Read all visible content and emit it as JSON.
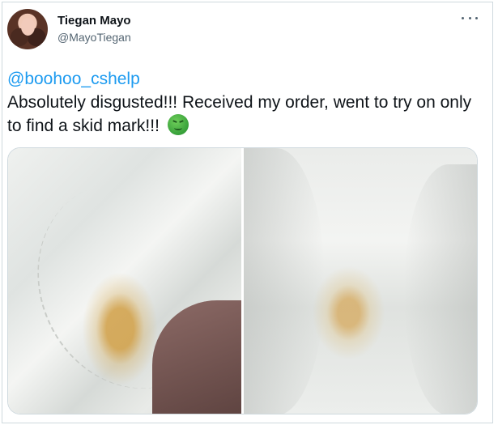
{
  "tweet": {
    "author": {
      "display_name": "Tiegan Mayo",
      "handle": "@MayoTiegan",
      "avatar": "profile-photo"
    },
    "mention": "@boohoo_cshelp",
    "text": "Absolutely disgusted!!! Received my order, went to try on only to find a skid mark!!!",
    "emoji": "nauseated-face",
    "media_count": 2,
    "colors": {
      "link": "#1d9bf0",
      "text": "#0f1419",
      "secondary": "#536471",
      "border": "#cfd9de"
    }
  },
  "icons": {
    "more": "more-options-icon"
  }
}
